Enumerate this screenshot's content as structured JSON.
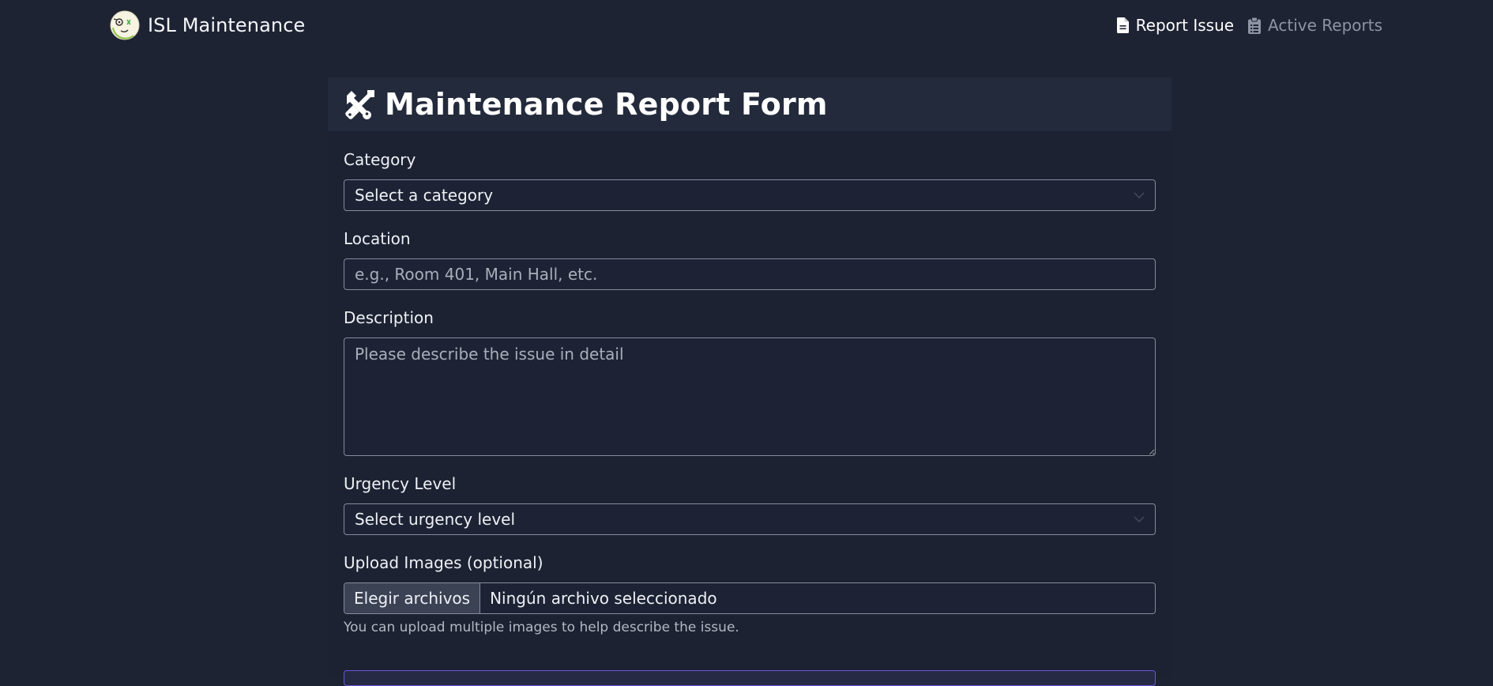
{
  "navbar": {
    "brand": "ISL Maintenance",
    "brand_icon": "cartoon-face-logo",
    "links": [
      {
        "label": "Report Issue",
        "icon": "file-icon",
        "active": true
      },
      {
        "label": "Active Reports",
        "icon": "clipboard-icon",
        "active": false
      }
    ]
  },
  "form": {
    "title": "Maintenance Report Form",
    "title_icon": "tools-icon",
    "category": {
      "label": "Category",
      "selected": "Select a category"
    },
    "location": {
      "label": "Location",
      "placeholder": "e.g., Room 401, Main Hall, etc.",
      "value": ""
    },
    "description": {
      "label": "Description",
      "placeholder": "Please describe the issue in detail",
      "value": ""
    },
    "urgency": {
      "label": "Urgency Level",
      "selected": "Select urgency level"
    },
    "upload": {
      "label": "Upload Images (optional)",
      "button": "Elegir archivos",
      "status": "Ningún archivo seleccionado",
      "help": "You can upload multiple images to help describe the issue."
    }
  },
  "colors": {
    "background": "#1e2333",
    "card_header": "#232a3b",
    "border": "#858c9b",
    "submit_border": "#6a55d6"
  }
}
